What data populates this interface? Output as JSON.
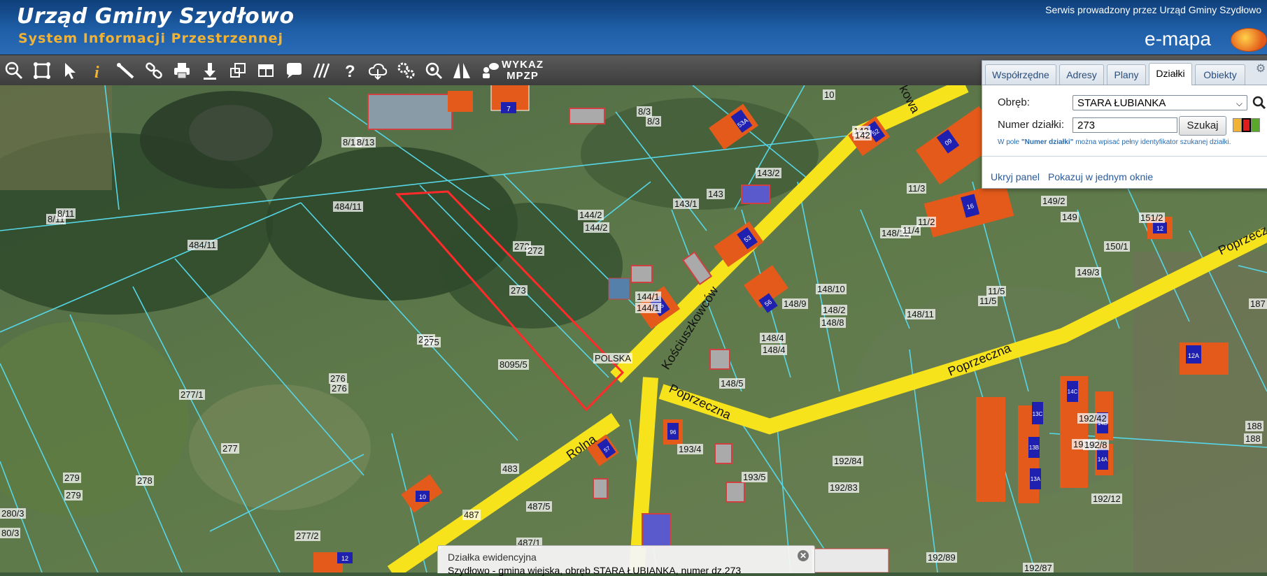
{
  "header": {
    "title": "Urząd Gminy Szydłowo",
    "subtitle": "System Informacji Przestrzennej",
    "service_text": "Serwis prowadzony przez Urząd Gminy Szydłowo",
    "logo_text": "e-mapa"
  },
  "toolbar": {
    "wykaz_line1": "WYKAZ",
    "wykaz_line2": "MPZP",
    "tools": [
      "zoom-out-icon",
      "zoom-extent-icon",
      "select-arrow-icon",
      "info-icon",
      "measure-icon",
      "link-icon",
      "print-icon",
      "download-icon",
      "layers-icon",
      "layout-icon",
      "comment-icon",
      "hatch-icon",
      "help-icon",
      "cloud-icon",
      "settings-icon",
      "search-map-icon",
      "road-icon",
      "chat-icon"
    ]
  },
  "panel": {
    "tabs": [
      "Współrzędne",
      "Adresy",
      "Plany",
      "Działki",
      "Obiekty"
    ],
    "active_tab": "Działki",
    "obreb_label": "Obręb:",
    "obreb_value": "STARA ŁUBIANKA",
    "numer_label": "Numer działki:",
    "numer_value": "273",
    "search_button": "Szukaj",
    "hint_prefix": "W pole ",
    "hint_bold": "\"Numer działki\"",
    "hint_suffix": " można wpisać pełny identyfikator szukanej działki.",
    "hide_panel": "Ukryj panel",
    "show_window": "Pokazuj w jednym oknie",
    "swatch_colors": [
      "#f2b233",
      "#e01b1b",
      "#5aa82a"
    ]
  },
  "map": {
    "streets": [
      "Kościuszkowców",
      "Poprzeczna",
      "Poprzeczna",
      "Rolna",
      "kowa"
    ],
    "parcel_labels": [
      "8/13",
      "8/13",
      "8/3",
      "8/3",
      "10",
      "142",
      "142",
      "484/11",
      "8/11",
      "8/11",
      "484/11",
      "143/2",
      "143/1",
      "143",
      "144/2",
      "144/2",
      "272",
      "272",
      "273",
      "275",
      "275",
      "8095/5",
      "276",
      "276",
      "277/1",
      "277",
      "279",
      "279",
      "278",
      "280/3",
      "80/3",
      "277/2",
      "483",
      "487",
      "487/5",
      "487/1",
      "144/1",
      "144/1",
      "148/9",
      "148/10",
      "148/2",
      "148/8",
      "148/4",
      "148/4",
      "148/5",
      "148/12",
      "148/11",
      "149/2",
      "149",
      "11/3",
      "11/2",
      "11/4",
      "11/5",
      "11/5",
      "151/2",
      "150/1",
      "149/3",
      "187",
      "193/4",
      "193/5",
      "192/83",
      "192/84",
      "192/42",
      "192/8",
      "192/8",
      "192/12",
      "192/89",
      "192/87",
      "188",
      "188",
      "POLSKA"
    ],
    "building_numbers": [
      "7",
      "53A",
      "52",
      "53",
      "55",
      "56",
      "57",
      "10",
      "12",
      "12A",
      "637",
      "09",
      "16",
      "S8",
      "14C",
      "14B",
      "14A",
      "13C",
      "13B",
      "13A",
      "96",
      "62"
    ]
  },
  "popup": {
    "title": "Działka ewidencyjna",
    "detail": "Szydłowo - gmina wiejska, obręb STARA ŁUBIANKA, numer dz.273"
  }
}
